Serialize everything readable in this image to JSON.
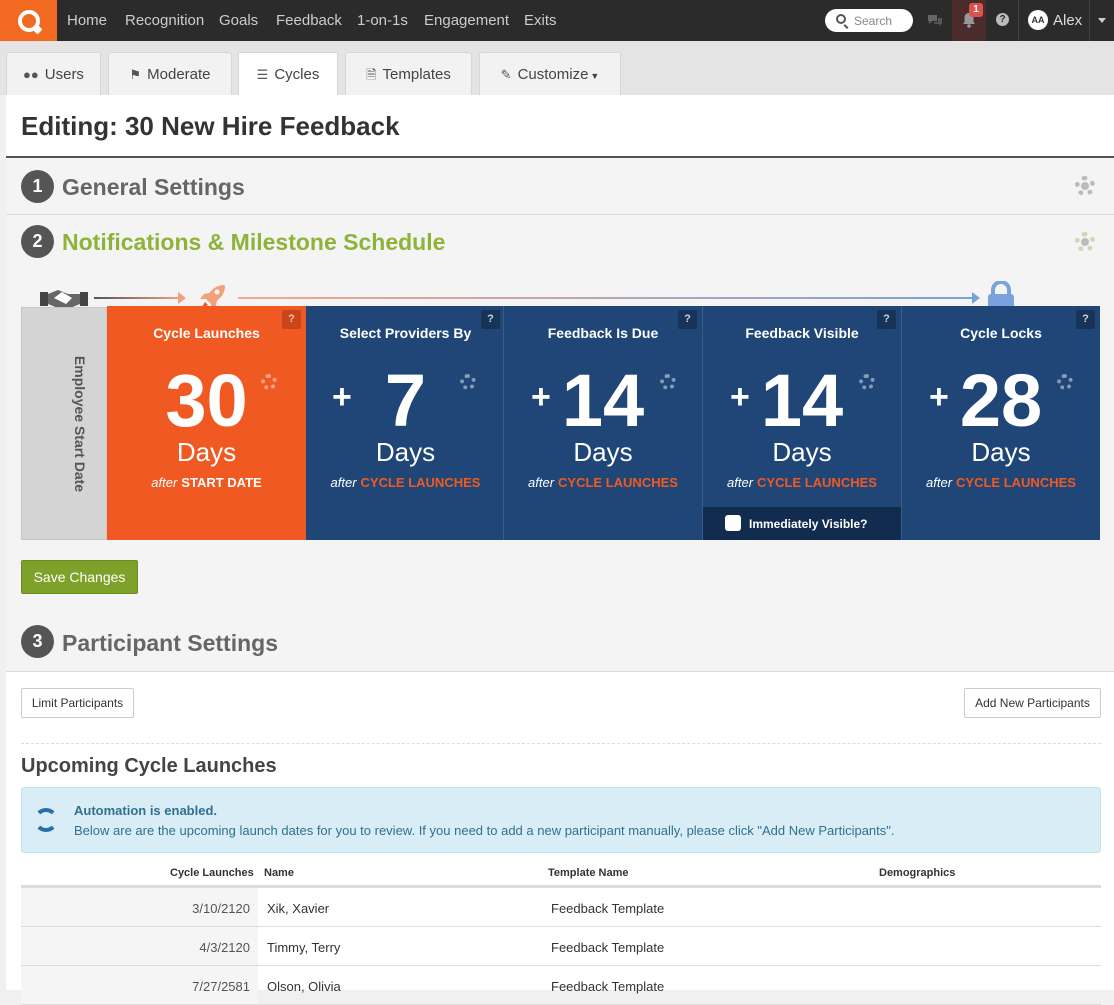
{
  "nav": {
    "items": [
      "Home",
      "Recognition",
      "Goals",
      "Feedback",
      "1-on-1s",
      "Engagement",
      "Exits"
    ],
    "search_placeholder": "Search",
    "notification_count": "1",
    "user_initials": "AA",
    "user_name": "Alex"
  },
  "tabs": [
    {
      "label": "Users",
      "icon": "users-icon"
    },
    {
      "label": "Moderate",
      "icon": "flag-icon"
    },
    {
      "label": "Cycles",
      "icon": "list-icon",
      "active": true
    },
    {
      "label": "Templates",
      "icon": "document-icon"
    },
    {
      "label": "Customize",
      "icon": "brush-icon"
    }
  ],
  "page": {
    "title": "Editing: 30 New Hire Feedback"
  },
  "sections": [
    {
      "num": "1",
      "title": "General Settings"
    },
    {
      "num": "2",
      "title": "Notifications & Milestone Schedule",
      "color": "#8fb339"
    },
    {
      "num": "3",
      "title": "Participant Settings"
    }
  ],
  "timeline": {
    "start_label": "Employee Start Date",
    "milestones": [
      {
        "title": "Cycle Launches",
        "prefix": "",
        "value": "30",
        "unit": "Days",
        "after": "after",
        "ref": "START DATE"
      },
      {
        "title": "Select Providers By",
        "prefix": "+",
        "value": "7",
        "unit": "Days",
        "after": "after",
        "ref": "CYCLE LAUNCHES"
      },
      {
        "title": "Feedback Is Due",
        "prefix": "+",
        "value": "14",
        "unit": "Days",
        "after": "after",
        "ref": "CYCLE LAUNCHES"
      },
      {
        "title": "Feedback Visible",
        "prefix": "+",
        "value": "14",
        "unit": "Days",
        "after": "after",
        "ref": "CYCLE LAUNCHES",
        "checkbox": "Immediately Visible?"
      },
      {
        "title": "Cycle Locks",
        "prefix": "+",
        "value": "28",
        "unit": "Days",
        "after": "after",
        "ref": "CYCLE LAUNCHES"
      }
    ],
    "help_glyph": "?",
    "colors": {
      "orange": "#f05a22",
      "blue": "#1f4677",
      "ref_accent": "#f05a22"
    }
  },
  "buttons": {
    "save": "Save Changes",
    "limit": "Limit Participants",
    "add": "Add New Participants"
  },
  "upcoming": {
    "title": "Upcoming Cycle Launches",
    "alert_title": "Automation is enabled.",
    "alert_body": "Below are are the upcoming launch dates for you to review. If you need to add a new participant manually, please click \"Add New Participants\".",
    "columns": [
      "Cycle Launches",
      "Name",
      "Template Name",
      "Demographics"
    ],
    "rows": [
      {
        "date": "3/10/2120",
        "name": "Xik, Xavier",
        "template": "Feedback Template"
      },
      {
        "date": "4/3/2120",
        "name": "Timmy, Terry",
        "template": "Feedback Template"
      },
      {
        "date": "7/27/2581",
        "name": "Olson, Olivia",
        "template": "Feedback Template"
      }
    ]
  }
}
